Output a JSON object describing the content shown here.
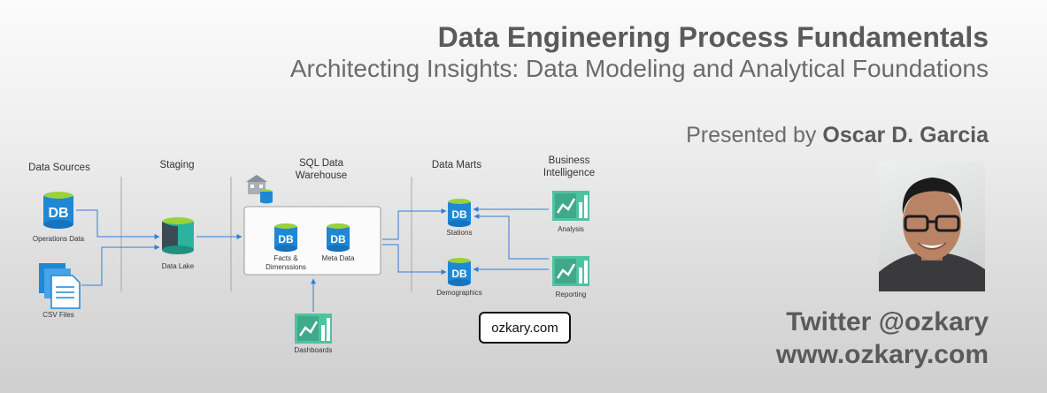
{
  "header": {
    "title": "Data Engineering Process Fundamentals",
    "subtitle": "Architecting Insights: Data Modeling and Analytical Foundations"
  },
  "presenter": {
    "prefix": "Presented by ",
    "name": "Oscar D. Garcia"
  },
  "contact": {
    "twitter": "Twitter @ozkary",
    "website": "www.ozkary.com"
  },
  "diagram": {
    "columns": {
      "sources": "Data Sources",
      "staging": "Staging",
      "warehouse_line1": "SQL Data",
      "warehouse_line2": "Warehouse",
      "marts": "Data Marts",
      "bi_line1": "Business",
      "bi_line2": "Intelligence"
    },
    "nodes": {
      "operations_data": "Operations Data",
      "csv_files": "CSV Files",
      "data_lake": "Data Lake",
      "facts_line1": "Facts &",
      "facts_line2": "Dimenssions",
      "meta_data": "Meta Data",
      "dashboards": "Dashboards",
      "stations": "Stations",
      "demographics": "Demographics",
      "analysis": "Analysis",
      "reporting": "Reporting"
    },
    "db_badge": "DB",
    "url_box": "ozkary.com"
  },
  "colors": {
    "db_blue": "#1e88d6",
    "db_teal": "#2bb3a0",
    "chart_green": "#4fc3a1",
    "arrow_blue": "#2f7ed8",
    "title_gray": "#5a5a5a"
  }
}
